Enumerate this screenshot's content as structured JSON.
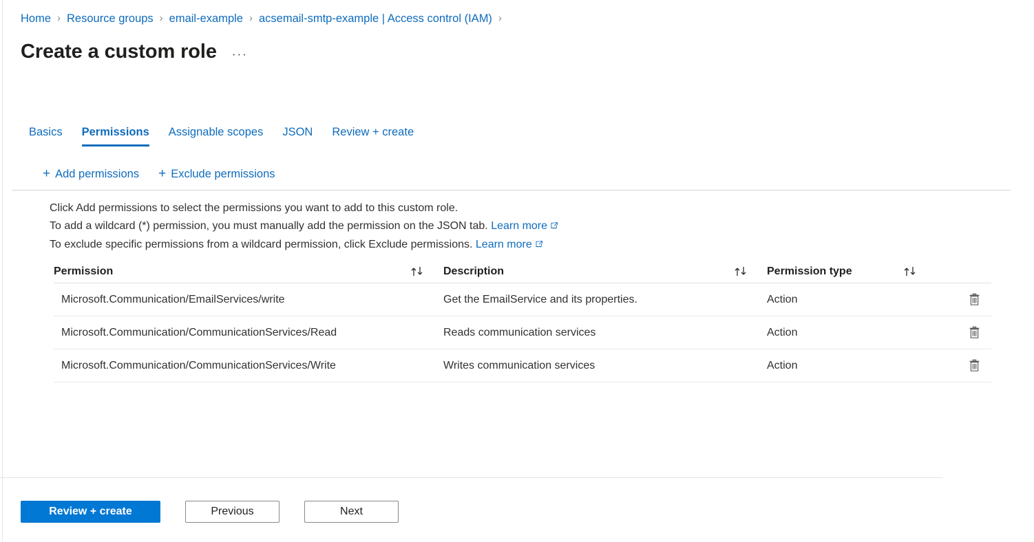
{
  "breadcrumb": {
    "items": [
      {
        "label": "Home"
      },
      {
        "label": "Resource groups"
      },
      {
        "label": "email-example"
      },
      {
        "label": "acsemail-smtp-example | Access control (IAM)"
      }
    ],
    "separator": "›",
    "trailing_separator": "›"
  },
  "header": {
    "title": "Create a custom role",
    "more_menu": "···"
  },
  "tabs": [
    {
      "label": "Basics",
      "active": false
    },
    {
      "label": "Permissions",
      "active": true
    },
    {
      "label": "Assignable scopes",
      "active": false
    },
    {
      "label": "JSON",
      "active": false
    },
    {
      "label": "Review + create",
      "active": false
    }
  ],
  "commandbar": {
    "add_permissions": "Add permissions",
    "exclude_permissions": "Exclude permissions",
    "plus": "+"
  },
  "instructions": {
    "line1": "Click Add permissions to select the permissions you want to add to this custom role.",
    "line2_text": "To add a wildcard (*) permission, you must manually add the permission on the JSON tab.",
    "line2_link": "Learn more",
    "line3_text": "To exclude specific permissions from a wildcard permission, click Exclude permissions.",
    "line3_link": "Learn more"
  },
  "table": {
    "columns": {
      "permission": "Permission",
      "description": "Description",
      "permission_type": "Permission type"
    },
    "rows": [
      {
        "permission": "Microsoft.Communication/EmailServices/write",
        "description": "Get the EmailService and its properties.",
        "type": "Action"
      },
      {
        "permission": "Microsoft.Communication/CommunicationServices/Read",
        "description": "Reads communication services",
        "type": "Action"
      },
      {
        "permission": "Microsoft.Communication/CommunicationServices/Write",
        "description": "Writes communication services",
        "type": "Action"
      }
    ]
  },
  "footer": {
    "review_create": "Review + create",
    "previous": "Previous",
    "next": "Next"
  },
  "colors": {
    "link": "#0f6cbd",
    "primary_button": "#0078d4",
    "tab_active": "#0f6cbd",
    "text": "#323130"
  }
}
